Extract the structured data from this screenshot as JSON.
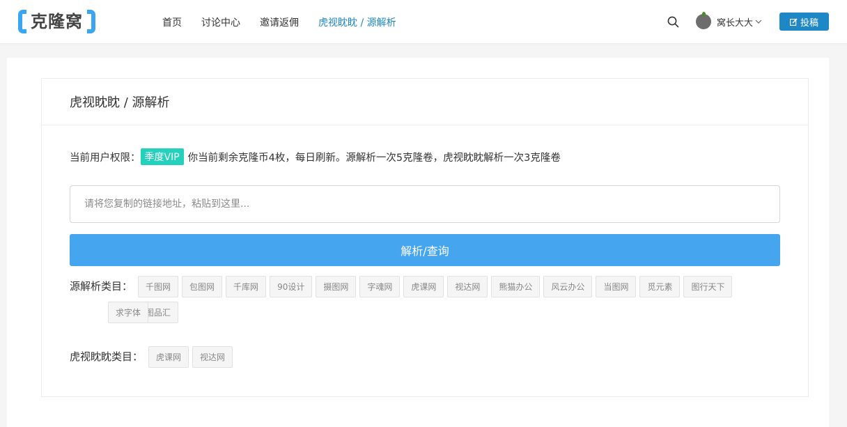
{
  "brand": {
    "name": "克隆窝",
    "color": "#3aa5f0"
  },
  "nav": [
    {
      "label": "首页",
      "active": false
    },
    {
      "label": "讨论中心",
      "active": false
    },
    {
      "label": "邀请返佣",
      "active": false
    },
    {
      "label": "虎视眈眈 / 源解析",
      "active": true
    }
  ],
  "header": {
    "search_icon": "search-icon",
    "user": {
      "name": "窝长大大",
      "avatar_icon": "onion-avatar-icon",
      "dropdown_icon": "chevron-down-icon"
    },
    "post_button": {
      "label": "投稿",
      "icon": "edit-icon",
      "color": "#1e88c7"
    }
  },
  "panel": {
    "title": "虎视眈眈 / 源解析",
    "permission_label": "当前用户权限：",
    "vip_badge": "季度VIP",
    "vip_color": "#23d1bd",
    "quota_text": "你当前剩余克隆币4枚，每日刷新。源解析一次5克隆卷，虎视眈眈解析一次3克隆卷",
    "input": {
      "value": "",
      "placeholder": "请将您复制的链接地址，粘贴到这里..."
    },
    "parse_button": "解析/查询",
    "parse_button_color": "#45a5ef",
    "source_categories": {
      "label": "源解析类目：",
      "items": [
        "千图网",
        "包图网",
        "千库网",
        "90设计",
        "摄图网",
        "字魂网",
        "虎课网",
        "视达网",
        "熊猫办公",
        "风云办公",
        "当图网",
        "觅元素",
        "图行天下",
        "图品汇",
        "求字体"
      ]
    },
    "video_categories": {
      "label": "虎视眈眈类目：",
      "items": [
        "虎课网",
        "视达网"
      ]
    }
  }
}
